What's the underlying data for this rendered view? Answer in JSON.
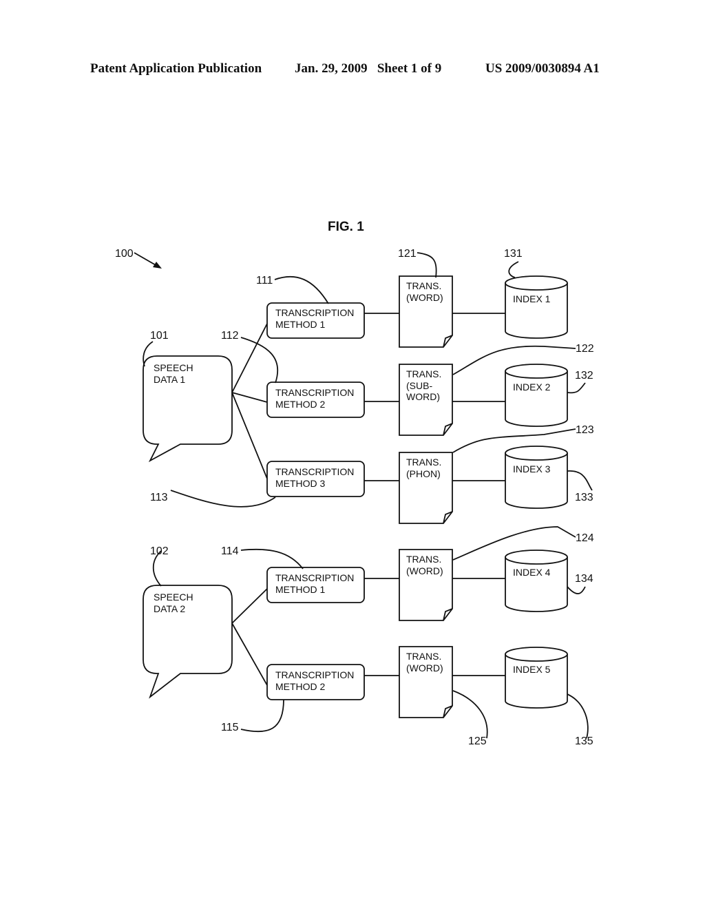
{
  "header": {
    "publication": "Patent Application Publication",
    "date_sheet": "Jan. 29, 2009   Sheet 1 of 9",
    "number": "US 2009/0030894 A1"
  },
  "figure": {
    "title": "FIG. 1",
    "system_ref": "100",
    "speech": [
      {
        "ref": "101",
        "line1": "SPEECH",
        "line2": "DATA 1"
      },
      {
        "ref": "102",
        "line1": "SPEECH",
        "line2": "DATA 2"
      }
    ],
    "methods": [
      {
        "ref": "111",
        "line1": "TRANSCRIPTION",
        "line2": "METHOD 1"
      },
      {
        "ref": "112",
        "line1": "TRANSCRIPTION",
        "line2": "METHOD 2"
      },
      {
        "ref": "113",
        "line1": "TRANSCRIPTION",
        "line2": "METHOD 3"
      },
      {
        "ref": "114",
        "line1": "TRANSCRIPTION",
        "line2": "METHOD 1"
      },
      {
        "ref": "115",
        "line1": "TRANSCRIPTION",
        "line2": "METHOD 2"
      }
    ],
    "transcripts": [
      {
        "ref": "121",
        "lines": [
          "TRANS.",
          "(WORD)"
        ]
      },
      {
        "ref": "122",
        "lines": [
          "TRANS.",
          "(SUB-",
          "WORD)"
        ]
      },
      {
        "ref": "123",
        "lines": [
          "TRANS.",
          "(PHON)"
        ]
      },
      {
        "ref": "124",
        "lines": [
          "TRANS.",
          "(WORD)"
        ]
      },
      {
        "ref": "125",
        "lines": [
          "TRANS.",
          "(WORD)"
        ]
      }
    ],
    "indexes": [
      {
        "ref": "131",
        "label": "INDEX 1"
      },
      {
        "ref": "132",
        "label": "INDEX 2"
      },
      {
        "ref": "133",
        "label": "INDEX 3"
      },
      {
        "ref": "134",
        "label": "INDEX 4"
      },
      {
        "ref": "135",
        "label": "INDEX 5"
      }
    ]
  }
}
